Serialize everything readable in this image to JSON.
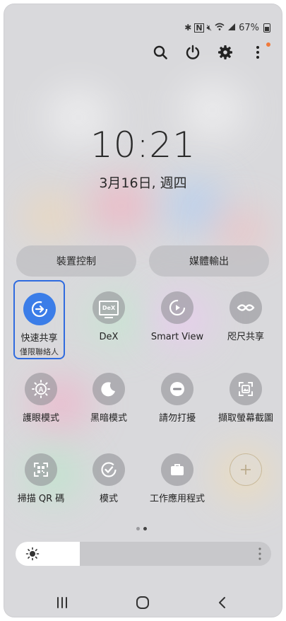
{
  "status_bar": {
    "battery": "67%"
  },
  "clock": {
    "time": "10:21",
    "date": "3月16日, 週四"
  },
  "top_buttons": [
    "search-icon",
    "power-icon",
    "settings-icon",
    "more-options-icon"
  ],
  "panels": {
    "device_control": "裝置控制",
    "media_output": "媒體輸出"
  },
  "tiles": [
    {
      "label": "快速共享",
      "sub": "僅限聯絡人",
      "icon": "quick-share-icon",
      "active": true
    },
    {
      "label": "DeX",
      "icon": "dex-icon"
    },
    {
      "label": "Smart View",
      "icon": "smart-view-icon"
    },
    {
      "label": "咫尺共享",
      "icon": "nearby-share-icon"
    },
    {
      "label": "護眼模式",
      "icon": "eye-comfort-icon"
    },
    {
      "label": "黑暗模式",
      "icon": "dark-mode-icon"
    },
    {
      "label": "請勿打擾",
      "icon": "do-not-disturb-icon"
    },
    {
      "label": "擷取螢幕截圖",
      "icon": "screenshot-icon"
    },
    {
      "label": "掃描 QR 碼",
      "icon": "qr-scan-icon"
    },
    {
      "label": "模式",
      "icon": "modes-icon"
    },
    {
      "label": "工作應用程式",
      "icon": "work-apps-icon"
    },
    {
      "label": "",
      "icon": "add-icon"
    }
  ],
  "dex_badge": "DeX",
  "brightness": {
    "level": 0.25
  },
  "accent_color": "#3b7de8",
  "active_outline": "#2f6bdf"
}
